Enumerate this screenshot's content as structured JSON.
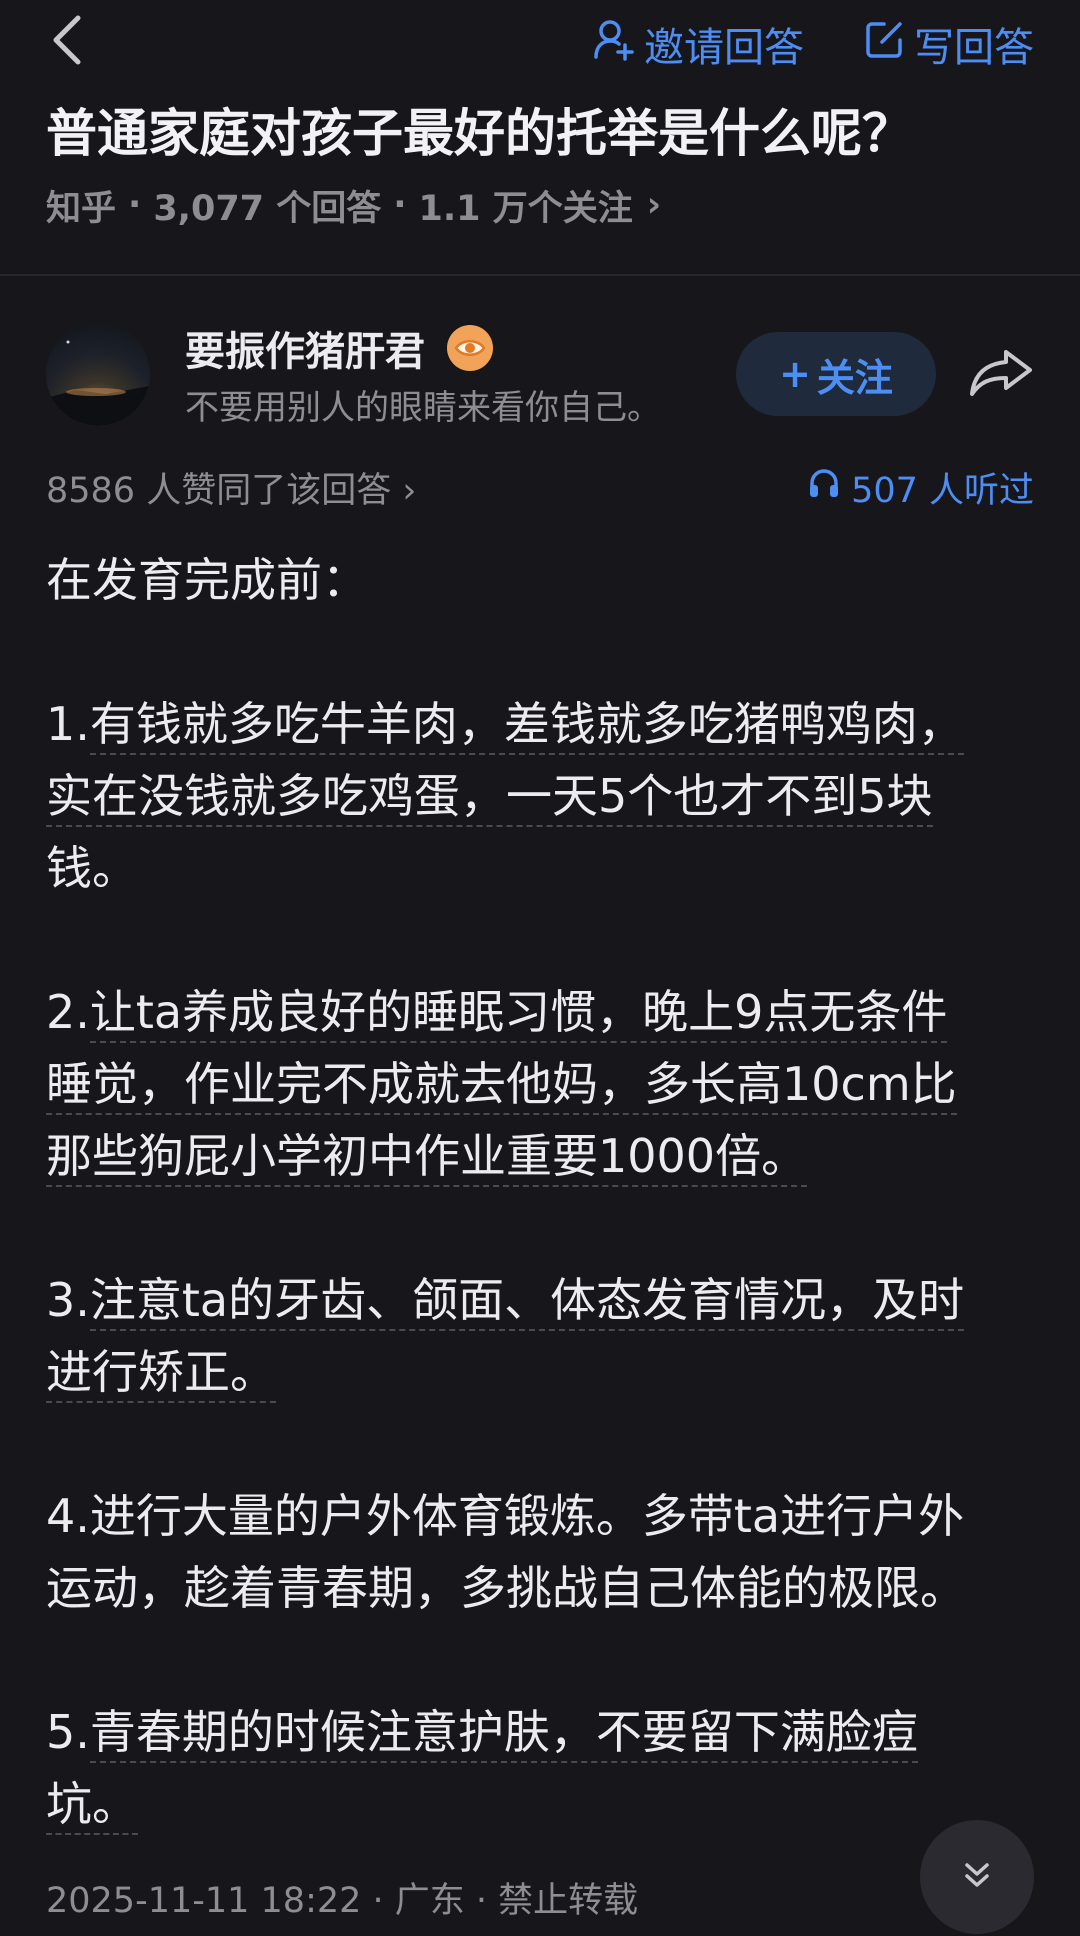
{
  "header": {
    "invite_label": "邀请回答",
    "write_label": "写回答"
  },
  "question": {
    "title": "普通家庭对孩子最好的托举是什么呢？",
    "source": "知乎",
    "answers": "3,077 个回答",
    "followers": "1.1 万个关注",
    "chevron": "›"
  },
  "author": {
    "name": "要振作猪肝君",
    "bio": "不要用别人的眼睛来看你自己。",
    "follow_label": "关注",
    "follow_plus": "+"
  },
  "stats": {
    "votes": "8586 人赞同了该回答 ›",
    "listens": "507 人听过"
  },
  "answer": {
    "intro": "在发育完成前：",
    "p1": {
      "lead": "1.",
      "line1": "有钱就多吃牛羊肉，差钱就多吃猪鸭鸡肉，",
      "line2": "实在没钱就多吃鸡蛋，一天5个也才不到5块",
      "line3": "钱。"
    },
    "p2": {
      "lead": "2.",
      "line1": "让ta养成良好的睡眠习惯，晚上9点无条件",
      "line2": "睡觉，作业完不成就去他妈，多长高10cm比",
      "line3": "那些狗屁小学初中作业重要1000倍。"
    },
    "p3": {
      "lead": "3.",
      "line1": "注意ta的牙齿、颌面、体态发育情况，及时",
      "line2": "进行矫正。"
    },
    "p4": {
      "line1": "4.进行大量的户外体育锻炼。多带ta进行户外",
      "line2": "运动，趁着青春期，多挑战自己体能的极限。"
    },
    "p5": {
      "lead": "5.",
      "line1": "青春期的时候注意护肤，不要留下满脸痘",
      "line2": "坑。"
    }
  },
  "footer": {
    "meta": "2025-11-11 18:22 · 广东 · 禁止转载"
  },
  "icons": {
    "back": "chevron-left-icon",
    "invite": "user-plus-icon",
    "write": "edit-icon",
    "share": "share-arrow-icon",
    "listen": "headphones-icon",
    "scroll": "double-chevron-down-icon"
  },
  "colors": {
    "background": "#17171b",
    "accent": "#4d8ef5",
    "muted": "#8d8d93",
    "text": "#ececee"
  }
}
